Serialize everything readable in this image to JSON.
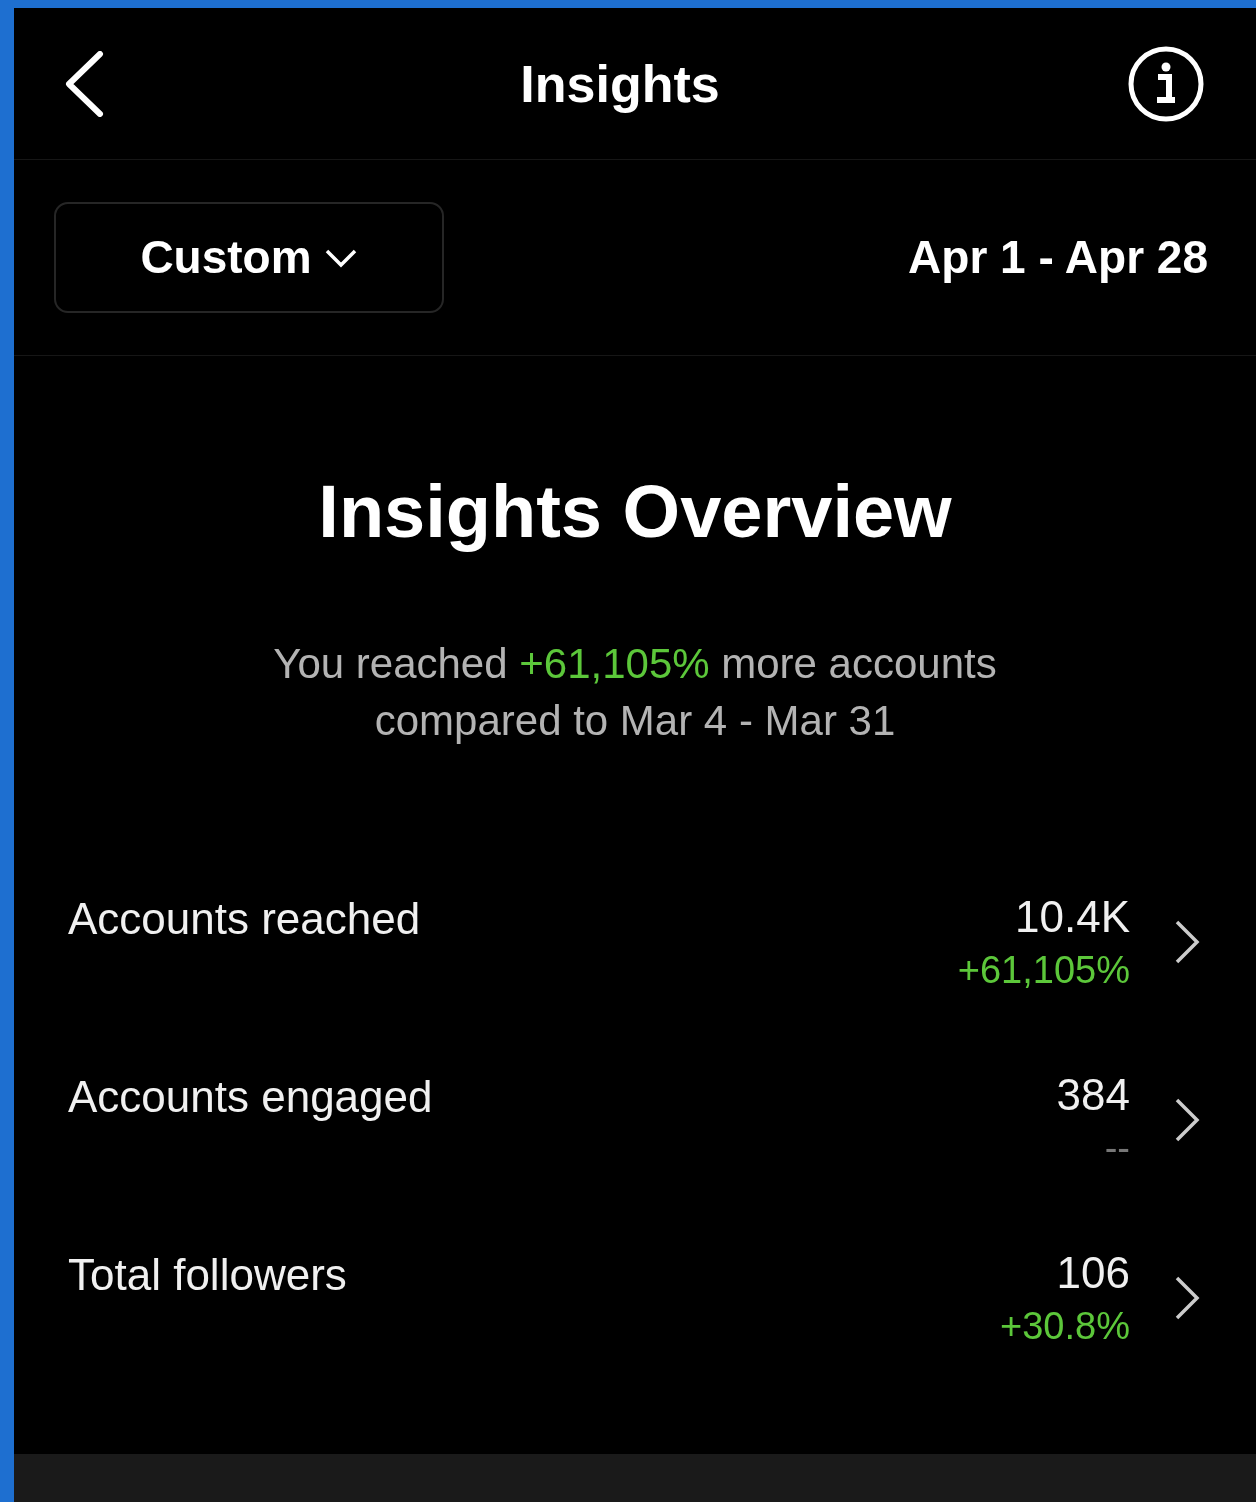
{
  "header": {
    "title": "Insights"
  },
  "range": {
    "dropdown": "Custom",
    "dates": "Apr 1 - Apr 28"
  },
  "overview": {
    "title": "Insights Overview",
    "summary": [
      {
        "text": "You reached ",
        "highlight": false
      },
      {
        "text": "+61,105%",
        "highlight": true
      },
      {
        "text": " more accounts compared to Mar 4 - Mar 31",
        "highlight": false
      }
    ]
  },
  "metrics": [
    {
      "label": "Accounts reached",
      "value": "10.4K",
      "change": "+61,105%",
      "color": "#5cc73a"
    },
    {
      "label": "Accounts engaged",
      "value": "384",
      "change": "--",
      "color": "#777777"
    },
    {
      "label": "Total followers",
      "value": "106",
      "change": "+30.8%",
      "color": "#5cc73a"
    }
  ]
}
